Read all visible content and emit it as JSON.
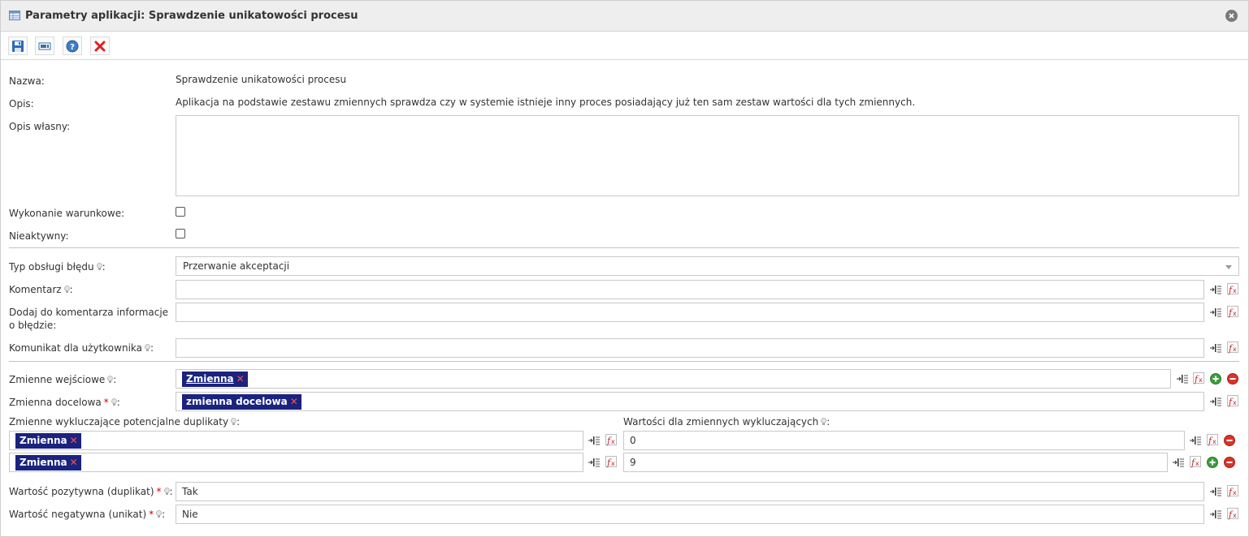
{
  "window": {
    "title": "Parametry aplikacji: Sprawdzenie unikatowości procesu",
    "icon": "table-icon",
    "close_icon": "close-circle-icon"
  },
  "toolbar": [
    {
      "id": "save",
      "icon": "save-icon"
    },
    {
      "id": "variable",
      "icon": "variable-icon"
    },
    {
      "id": "help",
      "icon": "help-icon"
    },
    {
      "id": "cancel",
      "icon": "cancel-icon"
    }
  ],
  "form": {
    "name_label": "Nazwa:",
    "name_value": "Sprawdzenie unikatowości procesu",
    "desc_label": "Opis:",
    "desc_value": "Aplikacja na podstawie zestawu zmiennych sprawdza czy w systemie istnieje inny proces posiadający już ten sam zestaw wartości dla tych zmiennych.",
    "own_desc_label": "Opis własny:",
    "own_desc_value": "",
    "conditional_label": "Wykonanie warunkowe:",
    "conditional_checked": false,
    "inactive_label": "Nieaktywny:",
    "inactive_checked": false,
    "error_type_label": "Typ obsługi błędu",
    "error_type_value": "Przerwanie akceptacji",
    "comment_label": "Komentarz",
    "comment_value": "",
    "add_comment_label": "Dodaj do komentarza informacje o błędzie:",
    "add_comment_value": "",
    "user_msg_label": "Komunikat dla użytkownika",
    "user_msg_value": "",
    "input_vars_label": "Zmienne wejściowe",
    "input_vars_tag": "Zmienna",
    "target_var_label": "Zmienna docelowa",
    "target_var_tag": "zmienna docelowa",
    "excl_vars_label": "Zmienne wykluczające potencjalne duplikaty",
    "excl_vals_label": "Wartości dla zmiennych wykluczających",
    "excl_rows": [
      {
        "tag": "Zmienna",
        "value": "0"
      },
      {
        "tag": "Zmienna",
        "value": "9"
      }
    ],
    "positive_label": "Wartość pozytywna (duplikat)",
    "positive_value": "Tak",
    "negative_label": "Wartość negatywna (unikat)",
    "negative_value": "Nie",
    "colon": ":",
    "required_mark": "*"
  },
  "colors": {
    "tag_bg": "#1a237e",
    "tag_remove": "#ff4d4d",
    "add_green": "#3c9e3c",
    "remove_red": "#d9342b"
  }
}
